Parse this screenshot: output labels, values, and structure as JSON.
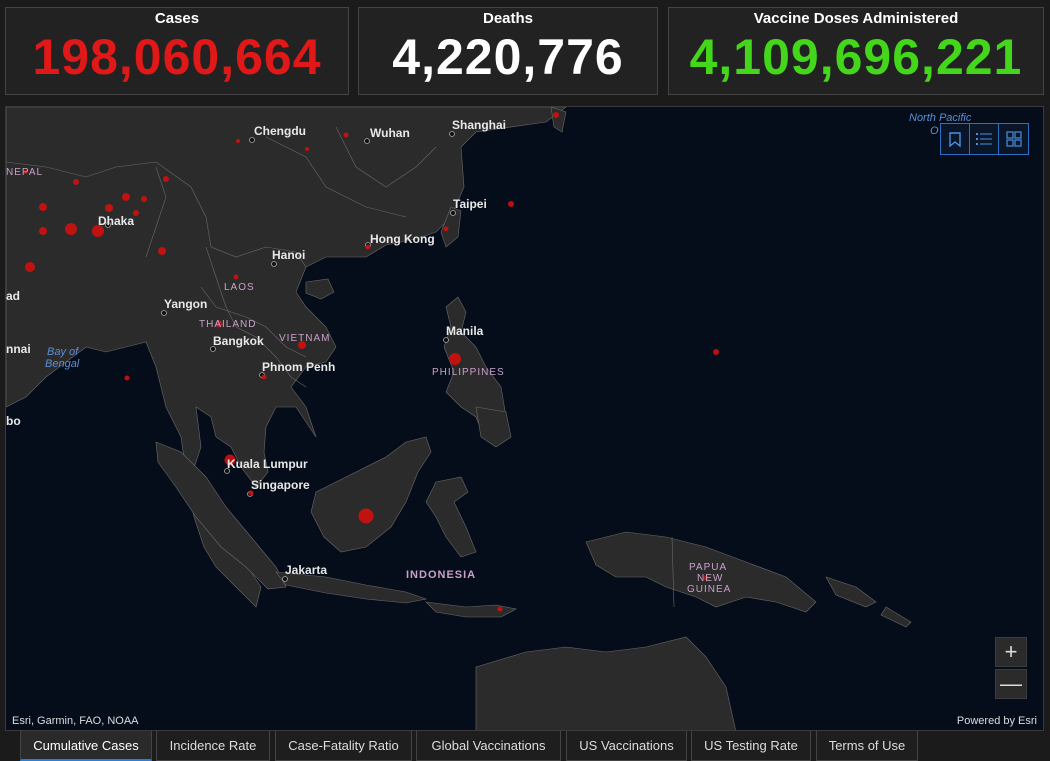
{
  "stats": {
    "cases": {
      "title": "Cases",
      "value": "198,060,664",
      "color": "#e01818"
    },
    "deaths": {
      "title": "Deaths",
      "value": "4,220,776",
      "color": "#ffffff"
    },
    "vaccines": {
      "title": "Vaccine Doses Administered",
      "value": "4,109,696,221",
      "color": "#44d61a"
    }
  },
  "map": {
    "cities": {
      "chengdu": "Chengdu",
      "wuhan": "Wuhan",
      "shanghai": "Shanghai",
      "dhaka": "Dhaka",
      "taipei": "Taipei",
      "hong_kong": "Hong Kong",
      "hanoi": "Hanoi",
      "yangon": "Yangon",
      "manila": "Manila",
      "bangkok": "Bangkok",
      "phnom_penh": "Phnom Penh",
      "kuala_lumpur": "Kuala Lumpur",
      "singapore": "Singapore",
      "jakarta": "Jakarta"
    },
    "countries": {
      "nepal": "NEPAL",
      "laos": "LAOS",
      "thailand": "THAILAND",
      "vietnam": "VIETNAM",
      "philippines": "PHILIPPINES",
      "indonesia": "INDONESIA",
      "papua_1": "PAPUA",
      "papua_2": "NEW",
      "papua_3": "GUINEA"
    },
    "seas": {
      "bay_1": "Bay of",
      "bay_2": "Bengal",
      "north_pacific": "North Pacific",
      "np_clip": "O"
    },
    "edge_fragments": {
      "ad": "ad",
      "nnai": "nnai",
      "bo": "bo"
    },
    "tools": [
      "bookmark-icon",
      "legend-icon",
      "basemap-gallery-icon"
    ],
    "zoom_in": "+",
    "zoom_out": "—",
    "attribution_left": "Esri, Garmin, FAO, NOAA",
    "attribution_right": "Powered by Esri",
    "marker_color": "#d10f0f"
  },
  "tabs": [
    {
      "label": "Cumulative Cases",
      "active": true
    },
    {
      "label": "Incidence Rate"
    },
    {
      "label": "Case-Fatality Ratio"
    },
    {
      "label": "Global Vaccinations"
    },
    {
      "label": "US Vaccinations"
    },
    {
      "label": "US Testing Rate"
    },
    {
      "label": "Terms of Use"
    }
  ]
}
